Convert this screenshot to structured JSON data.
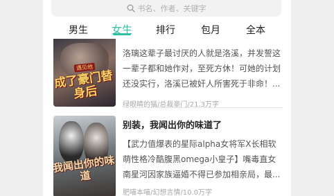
{
  "search": {
    "placeholder": "书名、作者、关键字",
    "icon": "search-icon"
  },
  "tabs": [
    {
      "label": "男生",
      "active": false
    },
    {
      "label": "女生",
      "active": true
    },
    {
      "label": "排行",
      "active": false
    },
    {
      "label": "包月",
      "active": false
    },
    {
      "label": "全本",
      "active": false
    }
  ],
  "books": [
    {
      "cover_text": "成了豪门替身后",
      "cover_badge": "遇见他",
      "description": "洛璃这辈子最讨厌的人就是洛溪，并发誓这一辈子都和她作对，至死方休！可她的计划还没实行，洛溪已被奸人所害死于非命！...",
      "author": "绿眼睛的猫",
      "category": "总裁豪门",
      "word_count": "21.3万字"
    },
    {
      "title": "别装，我闻出你的味道了",
      "cover_text": "我闻出你的味道",
      "description": "【武力值爆表的星际alpha女将军X长相软萌性格冷酷腹黑omega小皇子】嘴毒直女南星河因家族逼婚不得已参加相亲局，最...",
      "author": "肥喵本喵",
      "category": "幻想言情",
      "word_count": "10.0万字"
    }
  ],
  "colors": {
    "accent": "#2fbfa3"
  }
}
